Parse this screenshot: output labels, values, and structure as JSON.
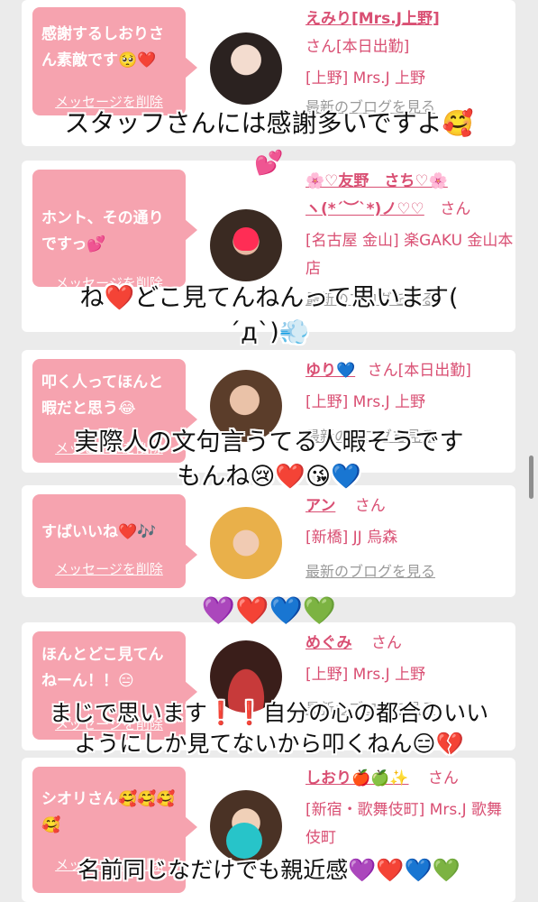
{
  "cards": [
    {
      "message": "感謝するしおりさん素敵です🥺❤️",
      "delete_label": "メッセージを削除",
      "name": "えみり[Mrs.J上野]",
      "san": "さん[本日出勤]",
      "shop": "[上野] Mrs.J 上野",
      "blog": "最新のブログを見る"
    },
    {
      "message": "ホント、その通りですっ💕",
      "delete_label": "メッセージを削除",
      "name": "🌸♡友野　さち♡🌸",
      "name2": "ヽ(*´︶`*)ノ♡♡",
      "san": "さん",
      "shop": "[名古屋 金山] 楽GAKU 金山本店",
      "blog": "最新のブログを見る"
    },
    {
      "message": "叩く人ってほんと暇だと思う😂",
      "delete_label": "メッセージを削除",
      "name": "ゆり💙",
      "san": "さん[本日出勤]",
      "shop": "[上野] Mrs.J 上野",
      "blog": "最新のブログを見る"
    },
    {
      "message": "すばいいね❤️🎶",
      "delete_label": "メッセージを削除",
      "name": "アン",
      "san": "さん",
      "shop": "[新橋] JJ 烏森",
      "blog": "最新のブログを見る"
    },
    {
      "message": "ほんとどこ見てんねーん！！😑",
      "delete_label": "メッセージを削除",
      "name": "めぐみ",
      "san": "さん",
      "shop": "[上野] Mrs.J 上野",
      "blog": "最新のブログを見る"
    },
    {
      "message": "シオリさん🥰🥰🥰🥰",
      "delete_label": "メッセージを削除",
      "name": "しおり🍎🍏✨",
      "san": "さん",
      "shop": "[新宿・歌舞伎町] Mrs.J 歌舞伎町",
      "blog": "最新のブログを見る"
    }
  ],
  "captions": {
    "c1": "スタッフさんには感謝多いですよ🥰",
    "c1b": "💕",
    "c2": "ね❤️どこ見てんねんって思います(\n´д`)💨",
    "c3": "実際人の文句言うてる人暇そうです\nもんね😢❤️😘💙",
    "c4": "💜❤️💙💚",
    "c5": "まじで思います❗️❗️自分の心の都合のいい\nようにしか見てないから叩くねん😑💔",
    "c6": "名前同じなだけでも親近感💜❤️💙💚"
  }
}
